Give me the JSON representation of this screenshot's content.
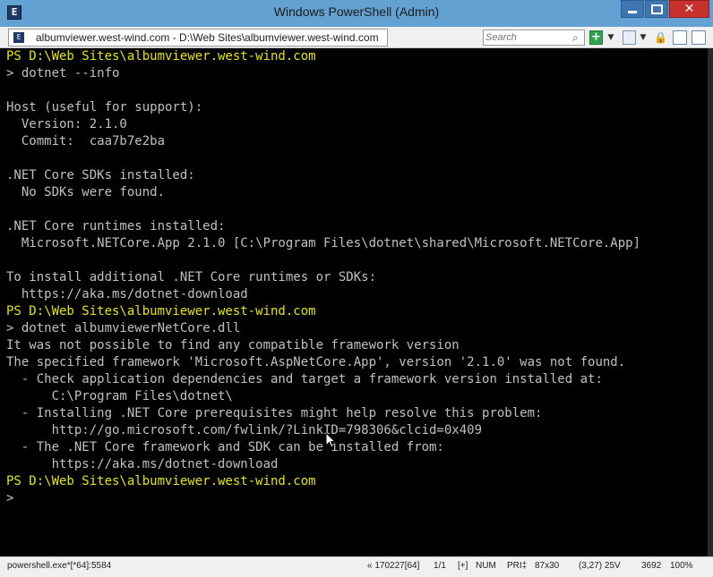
{
  "window": {
    "title": "Windows PowerShell (Admin)",
    "app_icon": "powershell-icon",
    "controls": {
      "minimize": "minimize-icon",
      "maximize": "maximize-icon",
      "close": "✕"
    }
  },
  "toolbar": {
    "tab_label": "albumviewer.west-wind.com - D:\\Web Sites\\albumviewer.west-wind.com",
    "tab_icon": "E",
    "search_placeholder": "Search",
    "add_label": "+",
    "dropdown_glyph": "▼",
    "lock_glyph": "🔒"
  },
  "console": {
    "prompt_color": "#e6e600",
    "text_color": "#c0c0c0",
    "background": "#000000",
    "lines": [
      {
        "text": "PS D:\\Web Sites\\albumviewer.west-wind.com",
        "kind": "prompt"
      },
      {
        "text": "> dotnet --info",
        "kind": "normal"
      },
      {
        "text": "",
        "kind": "normal"
      },
      {
        "text": "Host (useful for support):",
        "kind": "normal"
      },
      {
        "text": "  Version: 2.1.0",
        "kind": "normal"
      },
      {
        "text": "  Commit:  caa7b7e2ba",
        "kind": "normal"
      },
      {
        "text": "",
        "kind": "normal"
      },
      {
        "text": ".NET Core SDKs installed:",
        "kind": "normal"
      },
      {
        "text": "  No SDKs were found.",
        "kind": "normal"
      },
      {
        "text": "",
        "kind": "normal"
      },
      {
        "text": ".NET Core runtimes installed:",
        "kind": "normal"
      },
      {
        "text": "  Microsoft.NETCore.App 2.1.0 [C:\\Program Files\\dotnet\\shared\\Microsoft.NETCore.App]",
        "kind": "normal"
      },
      {
        "text": "",
        "kind": "normal"
      },
      {
        "text": "To install additional .NET Core runtimes or SDKs:",
        "kind": "normal"
      },
      {
        "text": "  https://aka.ms/dotnet-download",
        "kind": "normal"
      },
      {
        "text": "PS D:\\Web Sites\\albumviewer.west-wind.com",
        "kind": "prompt"
      },
      {
        "text": "> dotnet albumviewerNetCore.dll",
        "kind": "normal"
      },
      {
        "text": "It was not possible to find any compatible framework version",
        "kind": "normal"
      },
      {
        "text": "The specified framework 'Microsoft.AspNetCore.App', version '2.1.0' was not found.",
        "kind": "normal"
      },
      {
        "text": "  - Check application dependencies and target a framework version installed at:",
        "kind": "normal"
      },
      {
        "text": "      C:\\Program Files\\dotnet\\",
        "kind": "normal"
      },
      {
        "text": "  - Installing .NET Core prerequisites might help resolve this problem:",
        "kind": "normal"
      },
      {
        "text": "      http://go.microsoft.com/fwlink/?LinkID=798306&clcid=0x409",
        "kind": "normal"
      },
      {
        "text": "  - The .NET Core framework and SDK can be installed from:",
        "kind": "normal"
      },
      {
        "text": "      https://aka.ms/dotnet-download",
        "kind": "normal"
      },
      {
        "text": "PS D:\\Web Sites\\albumviewer.west-wind.com",
        "kind": "prompt"
      },
      {
        "text": ">",
        "kind": "normal"
      }
    ]
  },
  "statusbar": {
    "process": "powershell.exe*[*64]:5584",
    "build": "« 170227[64]",
    "pages": "1/1",
    "plus": "[+]",
    "num": "NUM",
    "pri": "PRI‡",
    "size": "87x30",
    "pos": "(3,27) 25V",
    "mem": "3692",
    "zoom": "100%"
  }
}
